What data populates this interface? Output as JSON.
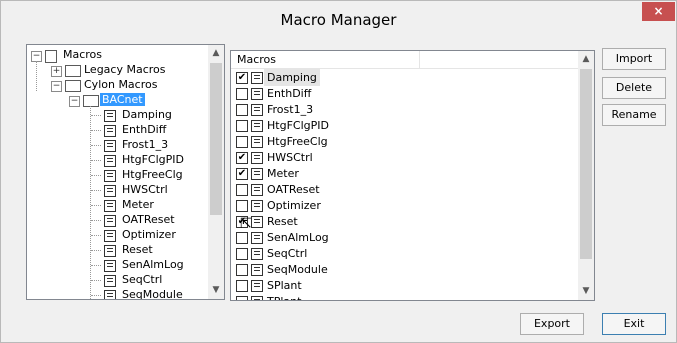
{
  "window": {
    "title": "Macro Manager",
    "close_glyph": "×"
  },
  "tree": {
    "root": "Macros",
    "legacy": "Legacy Macros",
    "cylon": "Cylon Macros",
    "bacnet": "BACnet",
    "items": [
      "Damping",
      "EnthDiff",
      "Frost1_3",
      "HtgFClgPID",
      "HtgFreeClg",
      "HWSCtrl",
      "Meter",
      "OATReset",
      "Optimizer",
      "Reset",
      "SenAlmLog",
      "SeqCtrl",
      "SeqModule"
    ]
  },
  "list": {
    "column": "Macros",
    "rows": [
      {
        "name": "Damping",
        "checked": true
      },
      {
        "name": "EnthDiff",
        "checked": false
      },
      {
        "name": "Frost1_3",
        "checked": false
      },
      {
        "name": "HtgFClgPID",
        "checked": false
      },
      {
        "name": "HtgFreeClg",
        "checked": false
      },
      {
        "name": "HWSCtrl",
        "checked": true
      },
      {
        "name": "Meter",
        "checked": true
      },
      {
        "name": "OATReset",
        "checked": false
      },
      {
        "name": "Optimizer",
        "checked": false
      },
      {
        "name": "Reset",
        "checked": true
      },
      {
        "name": "SenAlmLog",
        "checked": false
      },
      {
        "name": "SeqCtrl",
        "checked": false
      },
      {
        "name": "SeqModule",
        "checked": false
      },
      {
        "name": "SPlant",
        "checked": false
      },
      {
        "name": "TPlant",
        "checked": false
      }
    ]
  },
  "buttons": {
    "import": "Import",
    "delete": "Delete",
    "rename": "Rename",
    "export": "Export",
    "exit": "Exit"
  },
  "icons": {
    "check": "✔",
    "scroll_up": "▲",
    "scroll_down": "▼",
    "minus": "−",
    "plus": "+"
  }
}
